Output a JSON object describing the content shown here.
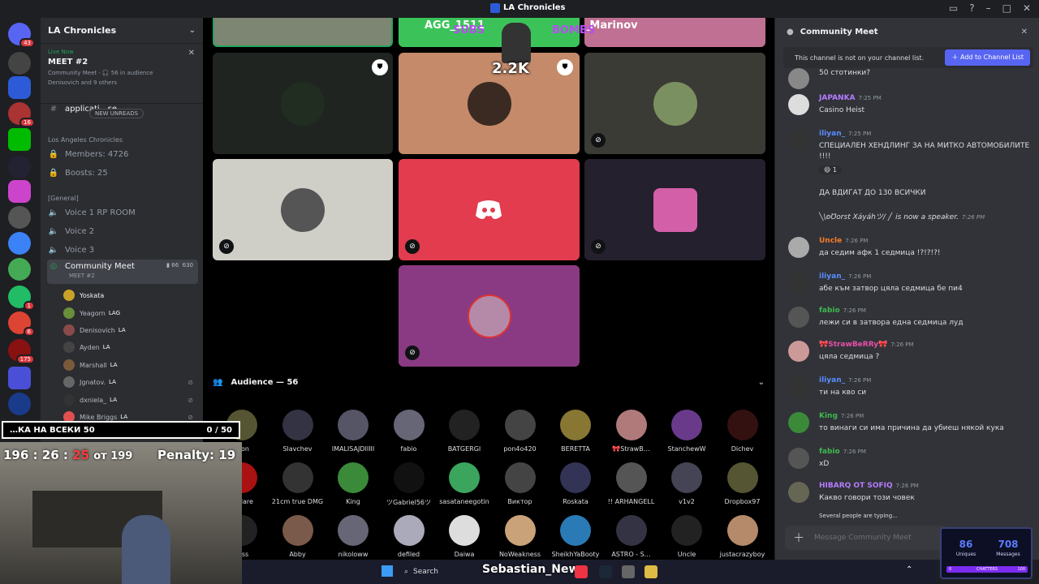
{
  "window": {
    "title": "LA Chronicles"
  },
  "server": {
    "name": "LA Chronicles",
    "event": {
      "live_label": "Live Now",
      "title": "MEET #2",
      "meta_1": "Community Meet · 🎧 56 in audience",
      "meta_2": "Denisovich and 9 others"
    },
    "new_unreads": "NEW UNREADS",
    "partial_channel": "applicati…se",
    "info_category": "Los Angeles Chronicles",
    "members": "Members: 4726",
    "boosts": "Boosts: 25",
    "general_category": "[General]",
    "voice_channels": [
      "Voice 1 RP ROOM",
      "Voice 2",
      "Voice 3"
    ],
    "stage_channel": {
      "name": "Community Meet",
      "sub": "MEET #2",
      "count_a": "66",
      "count_b": "630"
    },
    "stage_members": [
      {
        "name": "Yoskata",
        "tag": ""
      },
      {
        "name": "Yeagorn",
        "tag": "LAG"
      },
      {
        "name": "Denisovich",
        "tag": "LA"
      },
      {
        "name": "Ayden",
        "tag": "LA"
      },
      {
        "name": "Marshall",
        "tag": "LA"
      },
      {
        "name": "Jgnatov.",
        "tag": "LA"
      },
      {
        "name": "dxniela_",
        "tag": "LA"
      },
      {
        "name": "Mike Briggs",
        "tag": "LA"
      }
    ]
  },
  "rail_badges": [
    "43",
    "16",
    "1",
    "6",
    "175"
  ],
  "stage": {
    "top_tiles": [
      "AGG_1511",
      "Milen_Marinov"
    ],
    "overlay": {
      "subs": "SUBS",
      "bombs": "BOMBS",
      "counter": "2.2K"
    },
    "audience_header": "Audience — 56",
    "audience": [
      "…on",
      "Slavchev",
      "IMALISAJDIIIII",
      "fabio",
      "BATGERGI",
      "pon4o420",
      "BERETTA",
      "🎀StrawB…",
      "StanchewW",
      "Dichev",
      "…Mare",
      "21cm true DMG",
      "King",
      "ツGabriel56ツ",
      "sasataneegotin",
      "Виктор",
      "Roskata",
      "!! ARHANGELL",
      "v1v2",
      "Dropbox97",
      "…ss",
      "Abby",
      "nikoloww",
      "defiled",
      "Daiwa",
      "NoWeakness",
      "SheikhYaBooty",
      "ASTRO - S…",
      "Uncle",
      "justacrazyboy"
    ]
  },
  "chat": {
    "title": "Community Meet",
    "notice": "This channel is not on your channel list.",
    "add_button": "Add to Channel List",
    "messages": [
      {
        "who": "",
        "time": "",
        "text": "50 стотинки?",
        "color": "#dbdee1"
      },
      {
        "who": "JAPANKA",
        "time": "7:25 PM",
        "text": "Casino Heist",
        "color": "#b57cff"
      },
      {
        "who": "iliyan_",
        "time": "7:25 PM",
        "text": "СПЕЦИАЛЕН ХЕНДЛИНГ ЗА НА МИТКО АВТОМОБИЛИТЕ !!!!",
        "color": "#5b8cff"
      },
      {
        "who": "",
        "time": "",
        "text": "ДА ВДИГАТ ДО 130 ВСИЧКИ",
        "color": "#dbdee1"
      },
      {
        "who": "╲\\ʚ℧orst Xáyáhツ/ ╱",
        "time": "7:26 PM",
        "text": "is now a speaker.",
        "color": "#dbdee1"
      },
      {
        "who": "Uncle",
        "time": "7:26 PM",
        "text": "да седим афк 1 седмица !?!?!?!",
        "color": "#f57c2b"
      },
      {
        "who": "iliyan_",
        "time": "7:26 PM",
        "text": "абе към затвор цяла седмица бе пи4",
        "color": "#5b8cff"
      },
      {
        "who": "fabio",
        "time": "7:26 PM",
        "text": "лежи си в затвора една седмица луд",
        "color": "#3fb950"
      },
      {
        "who": "🎀StrawBeRRy🎀",
        "time": "7:26 PM",
        "text": "цяла седмица ?",
        "color": "#e84fa8"
      },
      {
        "who": "iliyan_",
        "time": "7:26 PM",
        "text": "ти на кво си",
        "color": "#5b8cff"
      },
      {
        "who": "King",
        "time": "7:26 PM",
        "text": "то винаги си има причина да убиеш някой кука",
        "color": "#3fb950"
      },
      {
        "who": "fabio",
        "time": "7:26 PM",
        "text": "xD",
        "color": "#3fb950"
      },
      {
        "who": "HIBARQ OT SOFIQ",
        "time": "7:26 PM",
        "text": "Какво говори този човек",
        "color": "#b57cff"
      }
    ],
    "reaction_count": "1",
    "typing": "Several people are typing...",
    "placeholder": "Message Community Meet"
  },
  "stats": {
    "uniques": "86",
    "uniques_label": "Uniques",
    "messages": "708",
    "messages_label": "Messages",
    "chatters_label": "CHATTERS",
    "chatters_min": "0",
    "chatters_max": "100"
  },
  "stream_overlay": {
    "task": "…КА НА ВСЕКИ 50",
    "task_count": "0 / 50",
    "timer_h": "196",
    "timer_m": "26",
    "timer_s": "25",
    "timer_suffix": "от 199",
    "penalty": "Penalty: 19",
    "streamer_name": "Sebastian_New"
  },
  "taskbar": {
    "search": "Search"
  }
}
